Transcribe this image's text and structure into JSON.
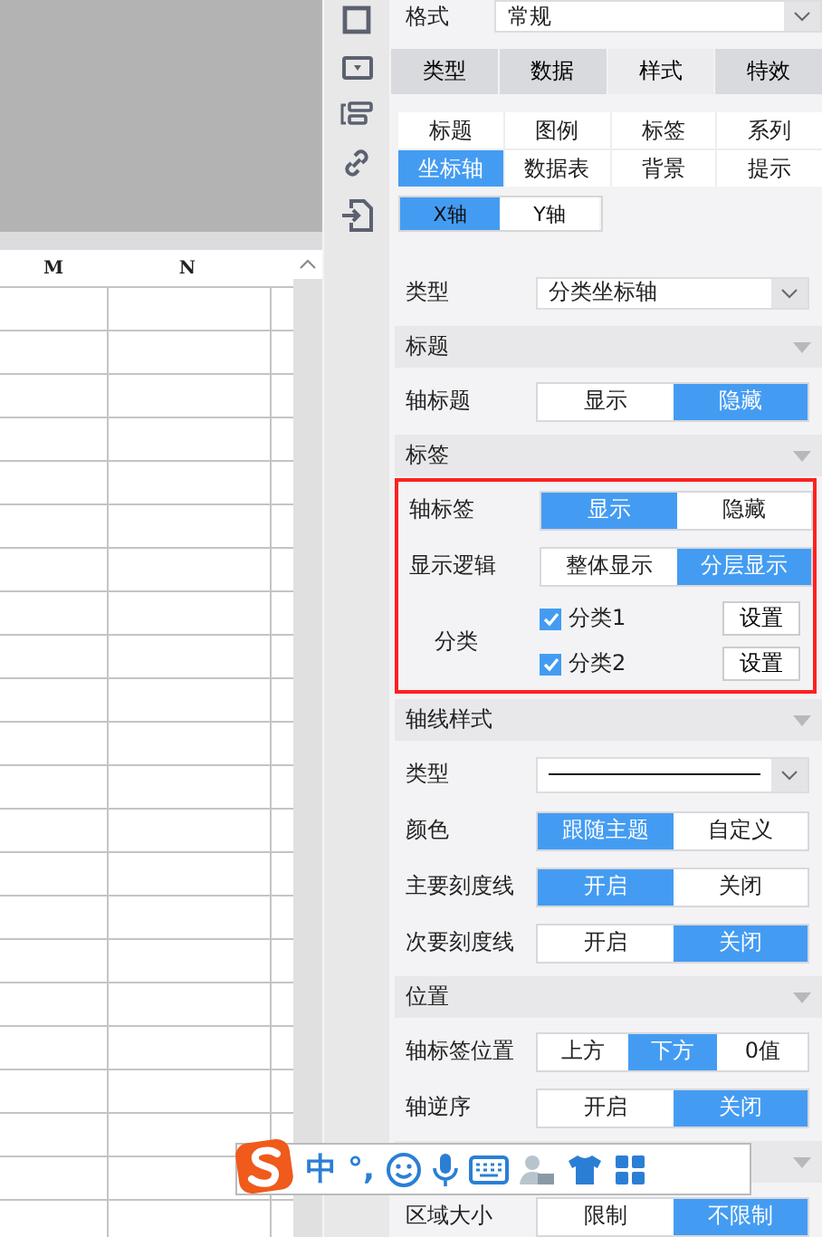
{
  "sheet": {
    "columns": [
      "M",
      "N"
    ]
  },
  "format": {
    "label": "格式",
    "value": "常规"
  },
  "tabs": [
    {
      "label": "类型",
      "selected": false
    },
    {
      "label": "数据",
      "selected": false
    },
    {
      "label": "样式",
      "selected": true
    },
    {
      "label": "特效",
      "selected": false
    }
  ],
  "sub_tabs": [
    {
      "label": "标题",
      "selected": false
    },
    {
      "label": "图例",
      "selected": false
    },
    {
      "label": "标签",
      "selected": false
    },
    {
      "label": "系列",
      "selected": false
    },
    {
      "label": "坐标轴",
      "selected": true
    },
    {
      "label": "数据表",
      "selected": false
    },
    {
      "label": "背景",
      "selected": false
    },
    {
      "label": "提示",
      "selected": false
    }
  ],
  "axis_tabs": [
    {
      "label": "X轴",
      "selected": true
    },
    {
      "label": "Y轴",
      "selected": false
    }
  ],
  "rows": [
    {
      "kind": "select",
      "label": "类型",
      "value": "分类坐标轴"
    },
    {
      "kind": "section",
      "label": "标题"
    },
    {
      "kind": "segmented",
      "label": "轴标题",
      "options": [
        {
          "label": "显示",
          "selected": false
        },
        {
          "label": "隐藏",
          "selected": true
        }
      ]
    },
    {
      "kind": "section",
      "label": "标签"
    },
    {
      "kind": "highlight",
      "rows": [
        {
          "kind": "segmented",
          "label": "轴标签",
          "options": [
            {
              "label": "显示",
              "selected": true
            },
            {
              "label": "隐藏",
              "selected": false
            }
          ]
        },
        {
          "kind": "segmented",
          "label": "显示逻辑",
          "options": [
            {
              "label": "整体显示",
              "selected": false
            },
            {
              "label": "分层显示",
              "selected": true
            }
          ]
        },
        {
          "kind": "categories",
          "label": "分类",
          "items": [
            {
              "label": "分类1",
              "checked": true,
              "button": "设置"
            },
            {
              "label": "分类2",
              "checked": true,
              "button": "设置"
            }
          ]
        }
      ]
    },
    {
      "kind": "section",
      "label": "轴线样式"
    },
    {
      "kind": "line-select",
      "label": "类型"
    },
    {
      "kind": "segmented",
      "label": "颜色",
      "options": [
        {
          "label": "跟随主题",
          "selected": true
        },
        {
          "label": "自定义",
          "selected": false
        }
      ]
    },
    {
      "kind": "segmented",
      "label": "主要刻度线",
      "options": [
        {
          "label": "开启",
          "selected": true
        },
        {
          "label": "关闭",
          "selected": false
        }
      ]
    },
    {
      "kind": "segmented",
      "label": "次要刻度线",
      "options": [
        {
          "label": "开启",
          "selected": false
        },
        {
          "label": "关闭",
          "selected": true
        }
      ]
    },
    {
      "kind": "section",
      "label": "位置"
    },
    {
      "kind": "segmented",
      "label": "轴标签位置",
      "options": [
        {
          "label": "上方",
          "selected": false
        },
        {
          "label": "下方",
          "selected": true
        },
        {
          "label": "0值",
          "selected": false
        }
      ]
    },
    {
      "kind": "segmented",
      "label": "轴逆序",
      "options": [
        {
          "label": "开启",
          "selected": false
        },
        {
          "label": "关闭",
          "selected": true
        }
      ]
    },
    {
      "kind": "section"
    },
    {
      "kind": "segmented",
      "label": "区域大小",
      "options": [
        {
          "label": "限制",
          "selected": false
        },
        {
          "label": "不限制",
          "selected": true
        }
      ]
    }
  ],
  "ime": {
    "items": [
      "中",
      "°,"
    ]
  }
}
